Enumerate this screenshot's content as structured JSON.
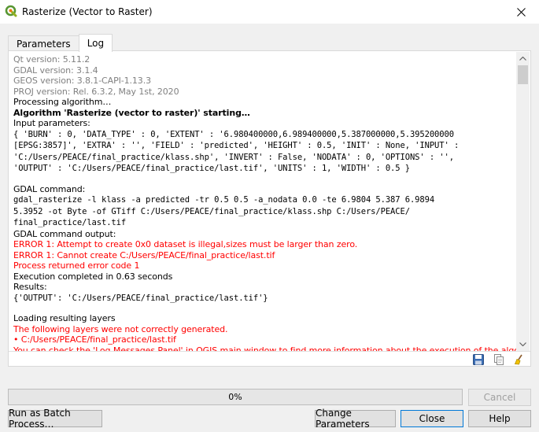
{
  "window": {
    "title": "Rasterize (Vector to Raster)"
  },
  "tabs": [
    {
      "label": "Parameters"
    },
    {
      "label": "Log"
    }
  ],
  "log": {
    "lines": [
      {
        "text": "Qt version: 5.11.2",
        "style": "gray"
      },
      {
        "text": "GDAL version: 3.1.4",
        "style": "gray"
      },
      {
        "text": "GEOS version: 3.8.1-CAPI-1.13.3",
        "style": "gray"
      },
      {
        "text": "PROJ version: Rel. 6.3.2, May 1st, 2020",
        "style": "gray"
      },
      {
        "text": "Processing algorithm…",
        "style": "normal"
      },
      {
        "text": "Algorithm 'Rasterize (vector to raster)' starting…",
        "style": "bold"
      },
      {
        "text": "Input parameters:",
        "style": "normal"
      },
      {
        "text": "{ 'BURN' : 0, 'DATA_TYPE' : 0, 'EXTENT' : '6.980400000,6.989400000,5.387000000,5.395200000",
        "style": "mono"
      },
      {
        "text": "[EPSG:3857]', 'EXTRA' : '', 'FIELD' : 'predicted', 'HEIGHT' : 0.5, 'INIT' : None, 'INPUT' :",
        "style": "mono"
      },
      {
        "text": "'C:/Users/PEACE/final_practice/klass.shp', 'INVERT' : False, 'NODATA' : 0, 'OPTIONS' : '',",
        "style": "mono"
      },
      {
        "text": "'OUTPUT' : 'C:/Users/PEACE/final_practice/last.tif', 'UNITS' : 1, 'WIDTH' : 0.5 }",
        "style": "mono"
      },
      {
        "text": "",
        "style": "blank"
      },
      {
        "text": "GDAL command:",
        "style": "normal"
      },
      {
        "text": "gdal_rasterize -l klass -a predicted -tr 0.5 0.5 -a_nodata 0.0 -te 6.9804 5.387 6.9894",
        "style": "mono"
      },
      {
        "text": "5.3952 -ot Byte -of GTiff C:/Users/PEACE/final_practice/klass.shp C:/Users/PEACE/",
        "style": "mono"
      },
      {
        "text": "final_practice/last.tif",
        "style": "mono"
      },
      {
        "text": "GDAL command output:",
        "style": "normal"
      },
      {
        "text": "ERROR 1: Attempt to create 0x0 dataset is illegal,sizes must be larger than zero.",
        "style": "red"
      },
      {
        "text": "ERROR 1: Cannot create C:/Users/PEACE/final_practice/last.tif",
        "style": "red"
      },
      {
        "text": "Process returned error code 1",
        "style": "red"
      },
      {
        "text": "Execution completed in 0.63 seconds",
        "style": "normal"
      },
      {
        "text": "Results:",
        "style": "normal"
      },
      {
        "text": "{'OUTPUT': 'C:/Users/PEACE/final_practice/last.tif'}",
        "style": "mono"
      },
      {
        "text": "",
        "style": "blank"
      },
      {
        "text": "Loading resulting layers",
        "style": "normal"
      },
      {
        "text": "The following layers were not correctly generated.",
        "style": "red"
      },
      {
        "text": "• C:/Users/PEACE/final_practice/last.tif",
        "style": "red"
      },
      {
        "text": "You can check the 'Log Messages Panel' in QGIS main window to find more information about the execution of the algorithm.",
        "style": "red"
      }
    ]
  },
  "toolbar_icons": [
    "save-icon",
    "copy-icon",
    "clear-icon"
  ],
  "progress": {
    "value": 0,
    "label": "0%"
  },
  "buttons": {
    "cancel": "Cancel",
    "batch": "Run as Batch Process…",
    "change_params": "Change Parameters",
    "close": "Close",
    "help": "Help"
  }
}
